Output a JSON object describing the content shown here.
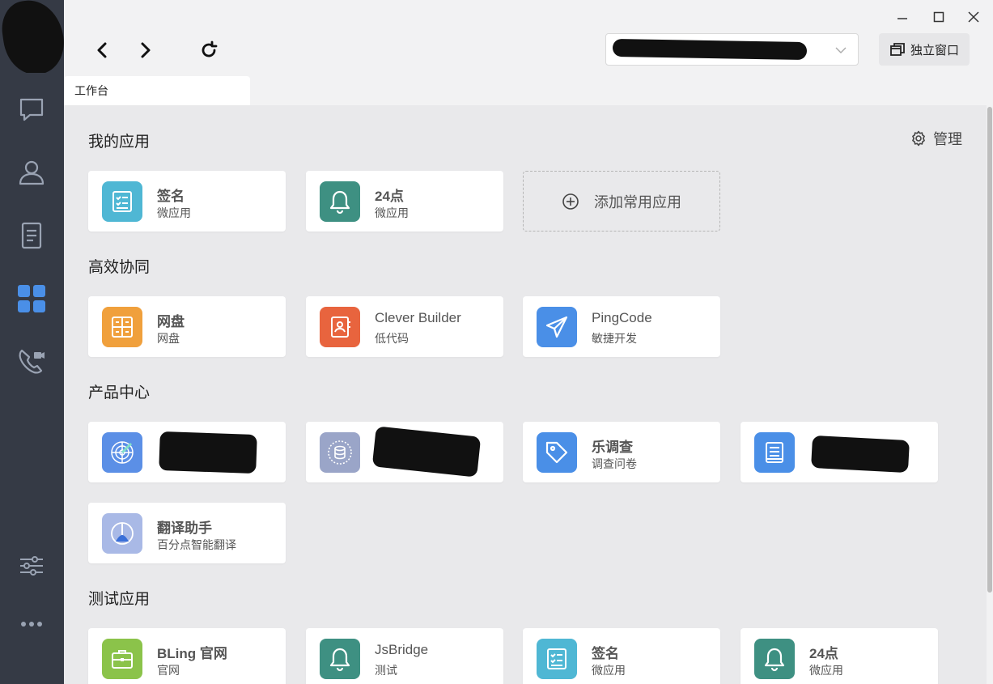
{
  "window": {
    "standalone_label": "独立窗口"
  },
  "tabs": [
    {
      "label": "工作台"
    }
  ],
  "header": {
    "manage_label": "管理"
  },
  "colors": {
    "sidebar_bg": "#353a45",
    "sidebar_icon": "#9aa3b3",
    "sidebar_active": "#4a8fe7",
    "content_bg": "#e9e9eb"
  },
  "sidebar": {
    "items": [
      {
        "icon": "chat-icon"
      },
      {
        "icon": "contacts-icon"
      },
      {
        "icon": "document-icon"
      },
      {
        "icon": "workbench-icon",
        "active": true
      },
      {
        "icon": "video-call-icon"
      },
      {
        "icon": "settings-sliders-icon"
      },
      {
        "icon": "more-icon"
      }
    ]
  },
  "sections": {
    "my_apps": {
      "title": "我的应用",
      "apps": [
        {
          "name": "签名",
          "desc": "微应用",
          "icon": "checklist-icon",
          "color": "#4fb7d4"
        },
        {
          "name": "24点",
          "desc": "微应用",
          "icon": "bell-icon",
          "color": "#3e9082"
        }
      ],
      "add_label": "添加常用应用"
    },
    "collab": {
      "title": "高效协同",
      "apps": [
        {
          "name": "网盘",
          "desc": "网盘",
          "icon": "cloud-disk-icon",
          "color": "#f0a03c"
        },
        {
          "name": "Clever Builder",
          "desc": "低代码",
          "icon": "contact-book-icon",
          "color": "#e8643e"
        },
        {
          "name": "PingCode",
          "desc": "敏捷开发",
          "icon": "paper-plane-icon",
          "color": "#4a8fe7"
        }
      ]
    },
    "products": {
      "title": "产品中心",
      "apps": [
        {
          "name": "",
          "desc": "",
          "icon": "radar-icon",
          "color": "#5b8fe6",
          "redacted": true
        },
        {
          "name": "",
          "desc": "",
          "icon": "database-icon",
          "color": "#9aa5c8",
          "redacted": true
        },
        {
          "name": "乐调查",
          "desc": "调查问卷",
          "icon": "tag-icon",
          "color": "#4a8fe7"
        },
        {
          "name": "",
          "desc": "",
          "icon": "book-icon",
          "color": "#4a8fe7",
          "redacted": true
        },
        {
          "name": "翻译助手",
          "desc": "百分点智能翻译",
          "icon": "translate-icon",
          "color": "#a9b9e6"
        }
      ]
    },
    "test": {
      "title": "测试应用",
      "apps": [
        {
          "name": "BLing 官网",
          "desc": "官网",
          "icon": "briefcase-icon",
          "color": "#8bc34a"
        },
        {
          "name": "JsBridge",
          "desc": "测试",
          "icon": "bell-icon",
          "color": "#3e9082"
        },
        {
          "name": "签名",
          "desc": "微应用",
          "icon": "checklist-icon",
          "color": "#4fb7d4"
        },
        {
          "name": "24点",
          "desc": "微应用",
          "icon": "bell-icon",
          "color": "#3e9082"
        }
      ]
    }
  }
}
